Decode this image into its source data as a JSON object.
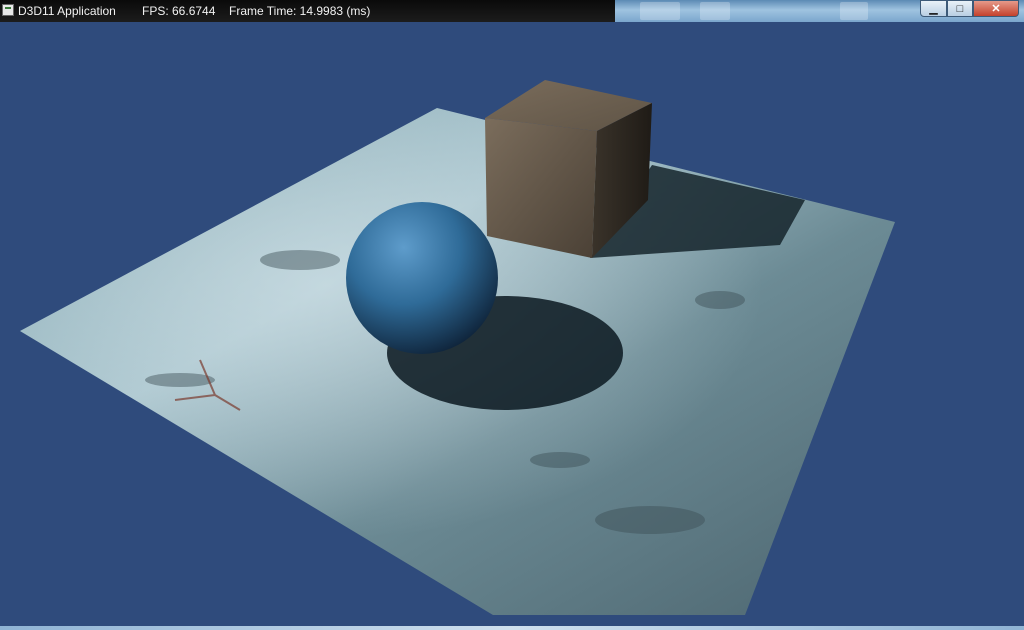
{
  "window": {
    "app_title": "D3D11 Application",
    "fps": "FPS: 66.6744",
    "frame_time": "Frame Time: 14.9983 (ms)",
    "controls": {
      "minimize": "▁",
      "maximize": "□",
      "close": "✕"
    }
  },
  "scene": {
    "clear_color": "#2f4b7c",
    "floor_color": "#6e8f9b",
    "sphere_color": "#2f6b98",
    "cube_color": "#5a4f42"
  }
}
